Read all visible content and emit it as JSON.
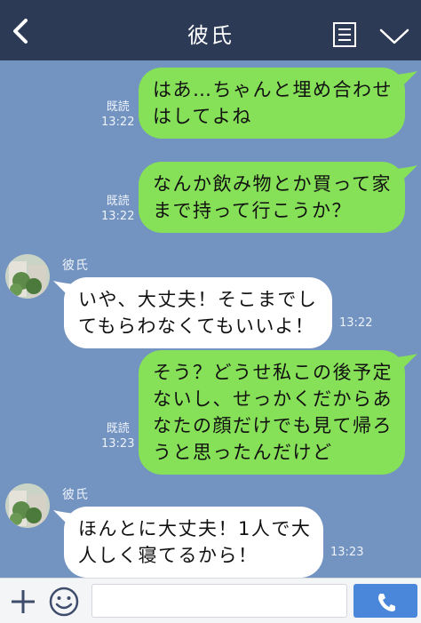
{
  "header": {
    "title": "彼氏"
  },
  "messages": [
    {
      "direction": "out",
      "text_lines": [
        "はあ…ちゃんと埋め合わせ",
        "はしてよね"
      ],
      "read_label": "既読",
      "time": "13:22"
    },
    {
      "direction": "out",
      "text_lines": [
        "なんか飲み物とか買って家",
        "まで持って行こうか？"
      ],
      "read_label": "既読",
      "time": "13:22"
    },
    {
      "direction": "in",
      "sender": "彼氏",
      "text_lines": [
        "いや、大丈夫！そこまでし",
        "てもらわなくてもいいよ！"
      ],
      "time": "13:22"
    },
    {
      "direction": "out",
      "text_lines": [
        "そう？どうせ私この後予定",
        "ないし、せっかくだからあ",
        "なたの顔だけでも見て帰ろ",
        "うと思ったんだけど"
      ],
      "read_label": "既読",
      "time": "13:23"
    },
    {
      "direction": "in",
      "sender": "彼氏",
      "text_lines": [
        "ほんとに大丈夫！1人で大",
        "人しく寝てるから！"
      ],
      "time": "13:23"
    }
  ],
  "colors": {
    "background": "#7393c1",
    "header": "#2c3a55",
    "bubble_out": "#86e058",
    "bubble_in": "#ffffff",
    "send_button": "#4a87db"
  },
  "icons": [
    "back-arrow-icon",
    "menu-list-icon",
    "chevron-down-icon",
    "plus-icon",
    "emoji-icon",
    "phone-icon"
  ]
}
